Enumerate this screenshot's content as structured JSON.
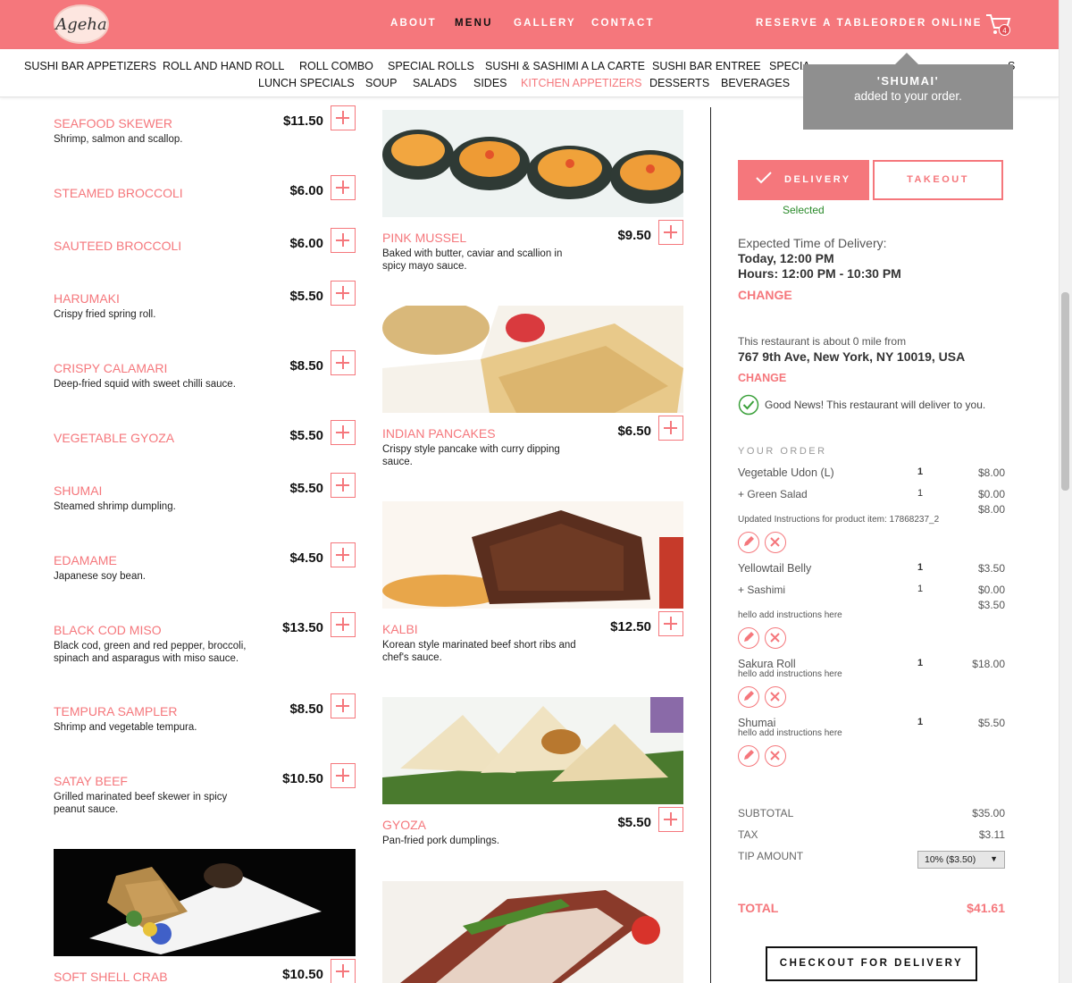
{
  "header": {
    "logo_text": "Ageha",
    "nav": [
      "ABOUT",
      "MENU",
      "GALLERY",
      "CONTACT"
    ],
    "reserve": "RESERVE A TABLE",
    "order_online": "ORDER ONLINE",
    "cart_count": "4"
  },
  "categories": {
    "row1": [
      "SUSHI BAR APPETIZERS",
      "ROLL AND HAND ROLL",
      "ROLL COMBO",
      "SPECIAL ROLLS",
      "SUSHI & SASHIMI A LA CARTE",
      "SUSHI BAR ENTREE",
      "SPECIA",
      "S"
    ],
    "row2": [
      "LUNCH SPECIALS",
      "SOUP",
      "SALADS",
      "SIDES",
      "KITCHEN APPETIZERS",
      "DESSERTS",
      "BEVERAGES"
    ]
  },
  "toast": {
    "title": "'SHUMAI'",
    "message": "added to your order."
  },
  "left_items": [
    {
      "name": "SEAFOOD SKEWER",
      "price": "$11.50",
      "desc": "Shrimp, salmon and scallop."
    },
    {
      "name": "STEAMED BROCCOLI",
      "price": "$6.00",
      "desc": ""
    },
    {
      "name": "SAUTEED BROCCOLI",
      "price": "$6.00",
      "desc": ""
    },
    {
      "name": "HARUMAKI",
      "price": "$5.50",
      "desc": "Crispy fried spring roll."
    },
    {
      "name": "CRISPY CALAMARI",
      "price": "$8.50",
      "desc": "Deep-fried squid with sweet chilli sauce."
    },
    {
      "name": "VEGETABLE GYOZA",
      "price": "$5.50",
      "desc": ""
    },
    {
      "name": "SHUMAI",
      "price": "$5.50",
      "desc": "Steamed shrimp dumpling."
    },
    {
      "name": "EDAMAME",
      "price": "$4.50",
      "desc": "Japanese soy bean."
    },
    {
      "name": "BLACK COD MISO",
      "price": "$13.50",
      "desc": "Black cod, green and red pepper, broccoli, spinach and asparagus with miso sauce."
    },
    {
      "name": "TEMPURA SAMPLER",
      "price": "$8.50",
      "desc": "Shrimp and vegetable tempura."
    },
    {
      "name": "SATAY BEEF",
      "price": "$10.50",
      "desc": "Grilled marinated beef skewer in spicy peanut sauce."
    },
    {
      "name": "SOFT SHELL CRAB",
      "price": "$10.50",
      "desc": ""
    }
  ],
  "right_items": [
    {
      "name": "PINK MUSSEL",
      "price": "$9.50",
      "desc": "Baked with butter, caviar and scallion in spicy mayo sauce."
    },
    {
      "name": "INDIAN PANCAKES",
      "price": "$6.50",
      "desc": "Crispy style pancake with curry dipping sauce."
    },
    {
      "name": "KALBI",
      "price": "$12.50",
      "desc": "Korean style marinated beef short ribs and chef's sauce."
    },
    {
      "name": "GYOZA",
      "price": "$5.50",
      "desc": "Pan-fried pork dumplings."
    }
  ],
  "order_panel": {
    "delivery": "DELIVERY",
    "takeout": "TAKEOUT",
    "selected": "Selected",
    "expected_label": "Expected Time of Delivery:",
    "expected_time": "Today, 12:00 PM",
    "hours": "Hours: 12:00 PM - 10:30 PM",
    "change": "CHANGE",
    "distance_text": "This restaurant is about 0 mile from",
    "address": "767 9th Ave, New York, NY 10019, USA",
    "good_news": "Good News! This restaurant will deliver to you.",
    "your_order": "YOUR ORDER",
    "lines": [
      {
        "name": "Vegetable Udon (L)",
        "qty": "1",
        "price": "$8.00"
      },
      {
        "name": "+ Green Salad",
        "qty": "1",
        "price": "$0.00",
        "subtotal": "$8.00",
        "note": "Updated Instructions for product item: 17868237_2"
      },
      {
        "name": "Yellowtail Belly",
        "qty": "1",
        "price": "$3.50"
      },
      {
        "name": "+ Sashimi",
        "qty": "1",
        "price": "$0.00",
        "subtotal": "$3.50",
        "note": "hello add instructions here"
      },
      {
        "name": "Sakura Roll",
        "qty": "1",
        "price": "$18.00",
        "note": "hello add instructions here"
      },
      {
        "name": "Shumai",
        "qty": "1",
        "price": "$5.50",
        "note": "hello add instructions here"
      }
    ],
    "subtotal_label": "SUBTOTAL",
    "subtotal": "$35.00",
    "tax_label": "TAX",
    "tax": "$3.11",
    "tip_label": "TIP AMOUNT",
    "tip": "10% ($3.50)",
    "total_label": "TOTAL",
    "total": "$41.61",
    "checkout": "CHECKOUT FOR DELIVERY"
  },
  "colors": {
    "accent": "#f5777c",
    "header": "#f5777c",
    "success": "#2a8a2a"
  }
}
